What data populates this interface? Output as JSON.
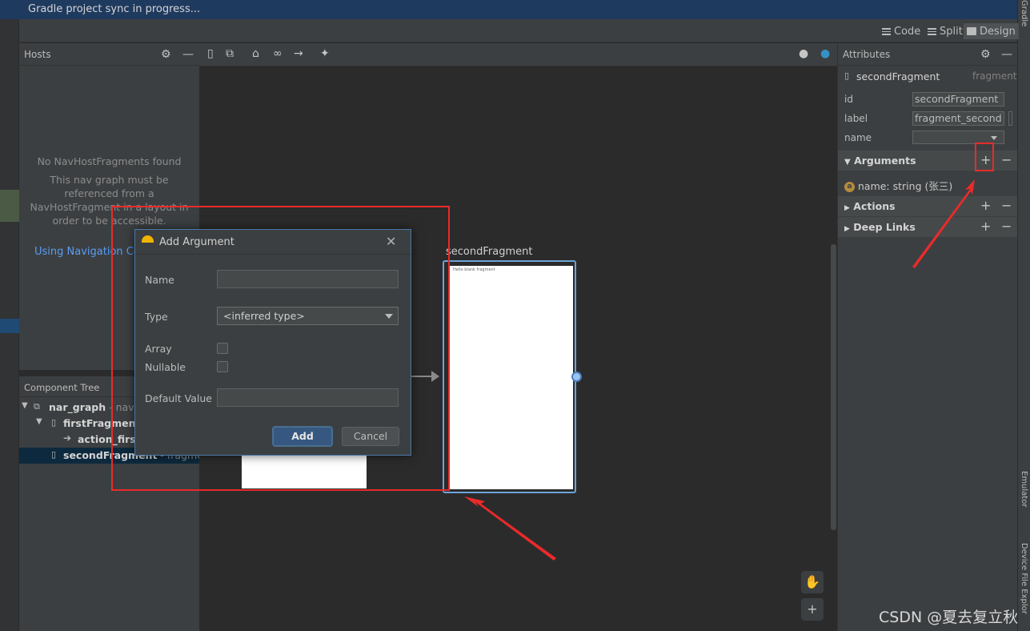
{
  "status": {
    "sync_message": "Gradle project sync in progress..."
  },
  "right_tools": {
    "gradle": "Gradle",
    "emulator": "Emulator",
    "device_file_explorer": "Device File Explor"
  },
  "view_modes": {
    "code": "Code",
    "split": "Split",
    "design": "Design",
    "active": "Design"
  },
  "hosts": {
    "title": "Hosts",
    "empty_title": "No NavHostFragments found",
    "empty_line1": "This nav graph must be",
    "empty_line2": "referenced from a",
    "empty_line3": "NavHostFragment in a layout in",
    "empty_line4": "order to be accessible.",
    "link": "Using Navigation Con"
  },
  "component_tree": {
    "title": "Component Tree",
    "rows": [
      {
        "name": "nar_graph",
        "suffix": " - naviga"
      },
      {
        "name": "firstFragment",
        "suffix": ""
      },
      {
        "name": "action_firstF",
        "suffix": ""
      },
      {
        "name": "secondFragment",
        "suffix": " - fragment"
      }
    ]
  },
  "canvas": {
    "second_fragment_label": "secondFragment",
    "second_fragment_text": "Hello blank fragment"
  },
  "attributes": {
    "title": "Attributes",
    "component_name": "secondFragment",
    "component_type": "fragment",
    "fields": [
      {
        "label": "id",
        "value": "secondFragment"
      },
      {
        "label": "label",
        "value": "fragment_second"
      },
      {
        "label": "name",
        "value": ""
      }
    ],
    "sections": {
      "arguments": "Arguments",
      "actions": "Actions",
      "deep_links": "Deep Links"
    },
    "argument_item": "name: string (张三)",
    "argument_badge": "a"
  },
  "dialog": {
    "title": "Add Argument",
    "name_label": "Name",
    "name_value": "",
    "type_label": "Type",
    "type_value": "<inferred type>",
    "array_label": "Array",
    "nullable_label": "Nullable",
    "default_label": "Default Value",
    "default_value": "",
    "add_button": "Add",
    "cancel_button": "Cancel"
  },
  "watermark": "CSDN @夏去复立秋",
  "colors": {
    "accent_blue": "#365880",
    "annotation_red": "#ea2a2a",
    "link_blue": "#589df6",
    "selection": "#0d293e"
  }
}
